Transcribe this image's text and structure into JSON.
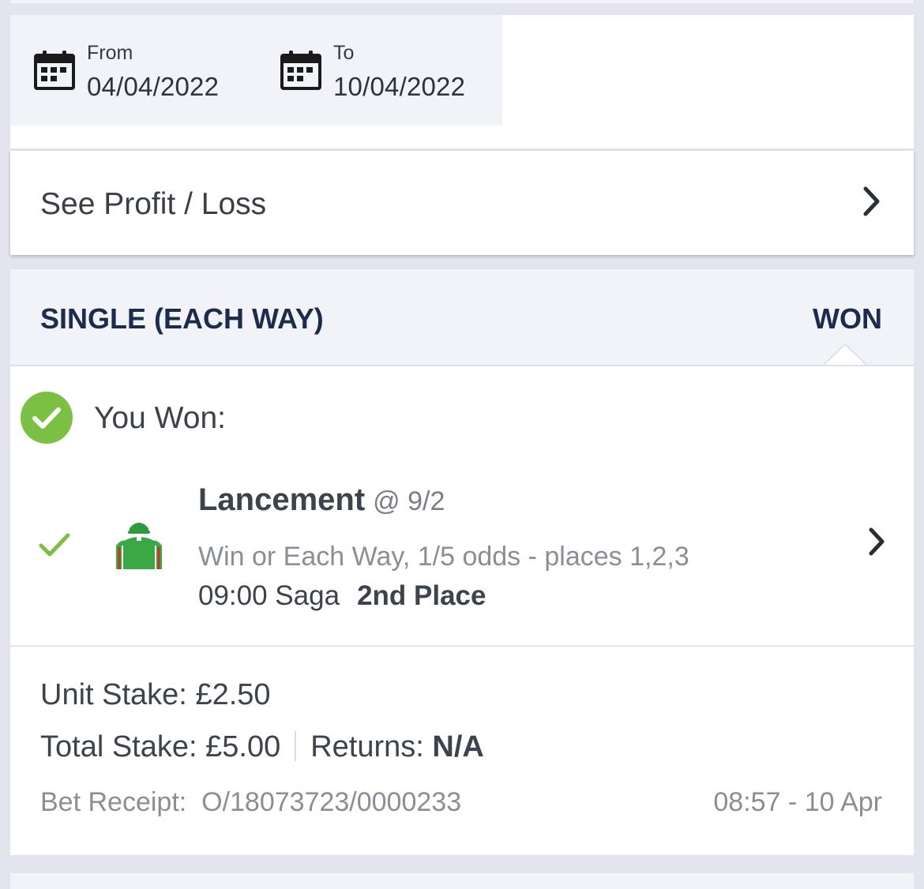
{
  "date_filter": {
    "from_label": "From",
    "from_date": "04/04/2022",
    "to_label": "To",
    "to_date": "10/04/2022"
  },
  "profit_loss": {
    "label": "See Profit / Loss"
  },
  "bet": {
    "type": "SINGLE (EACH WAY)",
    "status": "WON",
    "outcome_text": "You Won:",
    "selection": {
      "name": "Lancement",
      "odds": "@ 9/2",
      "market": "Win or Each Way, 1/5 odds - places 1,2,3",
      "race": "09:00 Saga",
      "result": "2nd Place"
    },
    "unit_stake_label": "Unit Stake:",
    "unit_stake_value": "£2.50",
    "total_stake_label": "Total Stake:",
    "total_stake_value": "£5.00",
    "returns_label": "Returns:",
    "returns_value": "N/A",
    "receipt_label": "Bet Receipt:",
    "receipt_id": "O/18073723/0000233",
    "placed_time": "08:57 - 10 Apr"
  },
  "colors": {
    "header_navy": "#1d2c4c",
    "won_green": "#7bc043",
    "card_bg": "#ffffff",
    "page_bg": "#e4e4ee"
  },
  "icons": [
    "calendar-icon",
    "chevron-right-icon",
    "check-circle-icon",
    "check-icon",
    "jockey-silks-icon"
  ]
}
